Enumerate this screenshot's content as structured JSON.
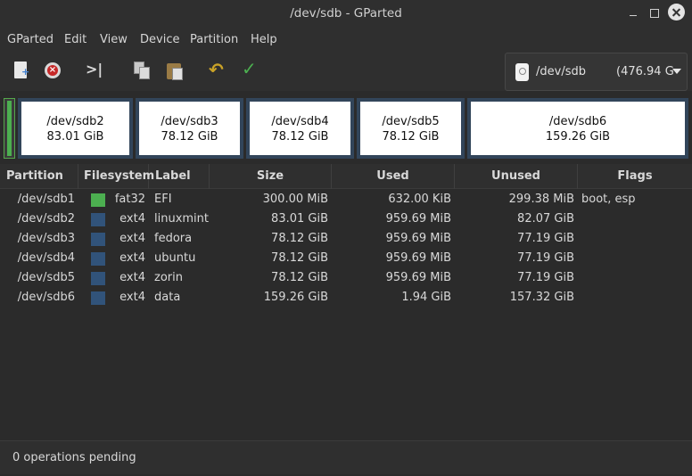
{
  "window": {
    "title": "/dev/sdb - GParted"
  },
  "menu": [
    "GParted",
    "Edit",
    "View",
    "Device",
    "Partition",
    "Help"
  ],
  "toolbar": {
    "icons": [
      "new-icon",
      "delete-icon",
      "resize-move-icon",
      "copy-icon",
      "paste-icon",
      "undo-icon",
      "apply-icon"
    ],
    "device": {
      "name": "/dev/sdb",
      "size": "(476.94 G"
    }
  },
  "disk_map": [
    {
      "name": "/dev/sdb2",
      "size": "83.01 GiB"
    },
    {
      "name": "/dev/sdb3",
      "size": "78.12 GiB"
    },
    {
      "name": "/dev/sdb4",
      "size": "78.12 GiB"
    },
    {
      "name": "/dev/sdb5",
      "size": "78.12 GiB"
    },
    {
      "name": "/dev/sdb6",
      "size": "159.26 GiB"
    }
  ],
  "table": {
    "headers": [
      "Partition",
      "Filesystem",
      "Label",
      "Size",
      "Used",
      "Unused",
      "Flags"
    ],
    "rows": [
      {
        "partition": "/dev/sdb1",
        "filesystem": "fat32",
        "fs_color": "#4caf50",
        "label": "EFI",
        "size": "300.00 MiB",
        "used": "632.00 KiB",
        "unused": "299.38 MiB",
        "flags": "boot, esp"
      },
      {
        "partition": "/dev/sdb2",
        "filesystem": "ext4",
        "fs_color": "#31537a",
        "label": "linuxmint",
        "size": "83.01 GiB",
        "used": "959.69 MiB",
        "unused": "82.07 GiB",
        "flags": ""
      },
      {
        "partition": "/dev/sdb3",
        "filesystem": "ext4",
        "fs_color": "#31537a",
        "label": "fedora",
        "size": "78.12 GiB",
        "used": "959.69 MiB",
        "unused": "77.19 GiB",
        "flags": ""
      },
      {
        "partition": "/dev/sdb4",
        "filesystem": "ext4",
        "fs_color": "#31537a",
        "label": "ubuntu",
        "size": "78.12 GiB",
        "used": "959.69 MiB",
        "unused": "77.19 GiB",
        "flags": ""
      },
      {
        "partition": "/dev/sdb5",
        "filesystem": "ext4",
        "fs_color": "#31537a",
        "label": "zorin",
        "size": "78.12 GiB",
        "used": "959.69 MiB",
        "unused": "77.19 GiB",
        "flags": ""
      },
      {
        "partition": "/dev/sdb6",
        "filesystem": "ext4",
        "fs_color": "#31537a",
        "label": "data",
        "size": "159.26 GiB",
        "used": "1.94 GiB",
        "unused": "157.32 GiB",
        "flags": ""
      }
    ]
  },
  "status": {
    "text": "0 operations pending"
  }
}
